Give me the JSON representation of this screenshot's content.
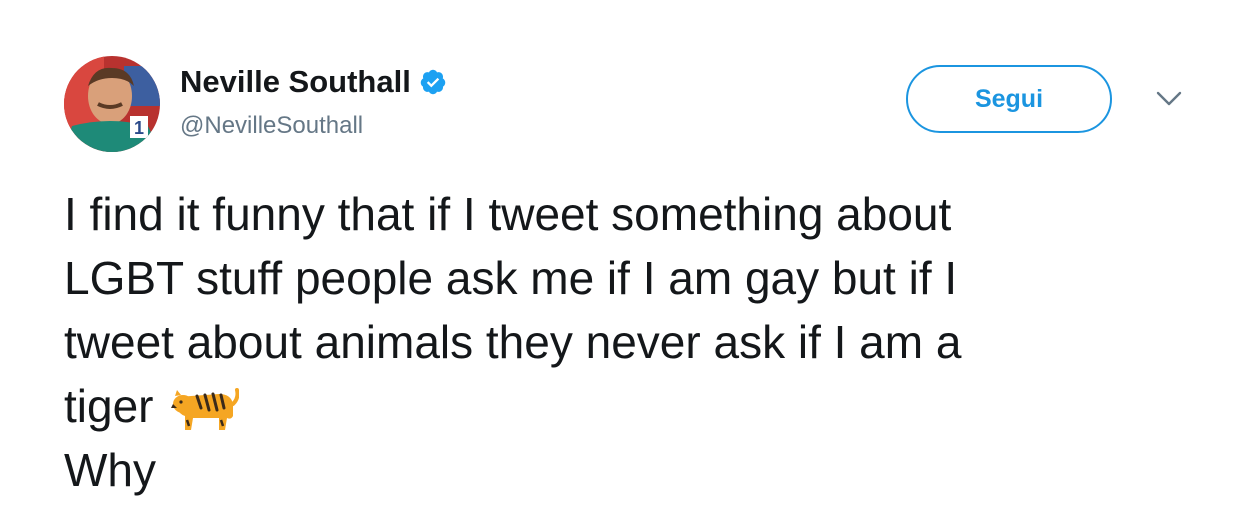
{
  "tweet": {
    "author": {
      "display_name": "Neville Southall",
      "handle": "@NevilleSouthall",
      "verified": true
    },
    "follow_button_label": "Segui",
    "text_lines": [
      "I find it funny that if I tweet something about",
      "LGBT stuff people ask me if I am gay but if I",
      "tweet about animals they never ask if I am a",
      "tiger",
      "Why"
    ],
    "emoji": "tiger-emoji"
  },
  "colors": {
    "accent": "#1b95e0",
    "text": "#14171a",
    "secondary_text": "#657786"
  },
  "icons": {
    "verified": "verified-badge-icon",
    "menu": "chevron-down-icon"
  }
}
